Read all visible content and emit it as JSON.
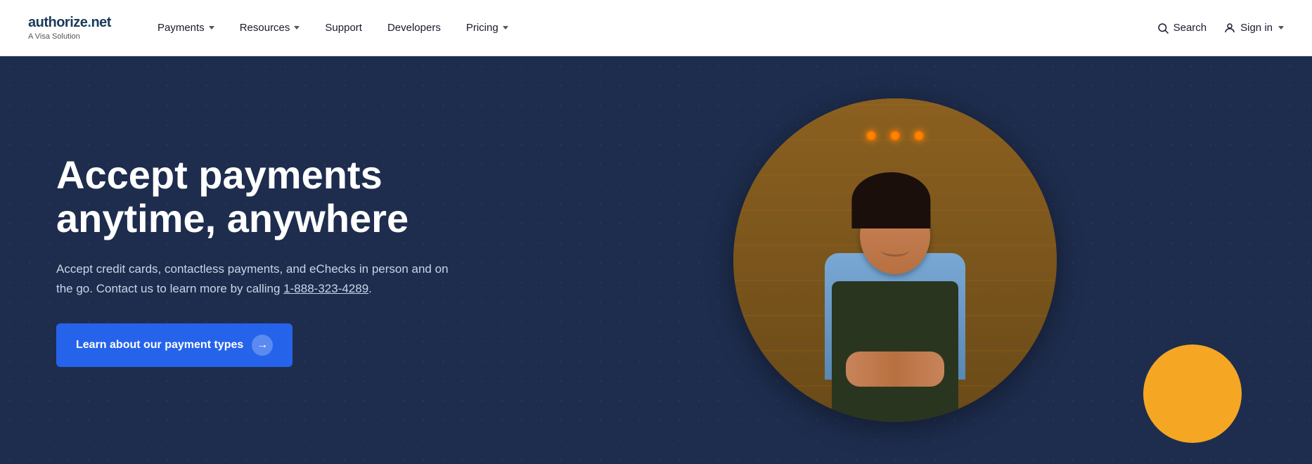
{
  "brand": {
    "name_part1": "authorize",
    "name_dot": ".",
    "name_part2": "net",
    "tagline": "A Visa Solution"
  },
  "navbar": {
    "items": [
      {
        "label": "Payments",
        "has_dropdown": true
      },
      {
        "label": "Resources",
        "has_dropdown": true
      },
      {
        "label": "Support",
        "has_dropdown": false
      },
      {
        "label": "Developers",
        "has_dropdown": false
      },
      {
        "label": "Pricing",
        "has_dropdown": true
      }
    ],
    "search_label": "Search",
    "signin_label": "Sign in"
  },
  "hero": {
    "title": "Accept payments anytime, anywhere",
    "description_part1": "Accept credit cards, contactless payments, and eChecks in person and on the go. Contact us to learn more by calling ",
    "phone": "1-888-323-4289",
    "description_part2": ".",
    "cta_label": "Learn about our payment types"
  },
  "colors": {
    "hero_bg": "#1e2d4e",
    "cta_blue": "#2563eb",
    "accent_yellow": "#f5a623"
  }
}
